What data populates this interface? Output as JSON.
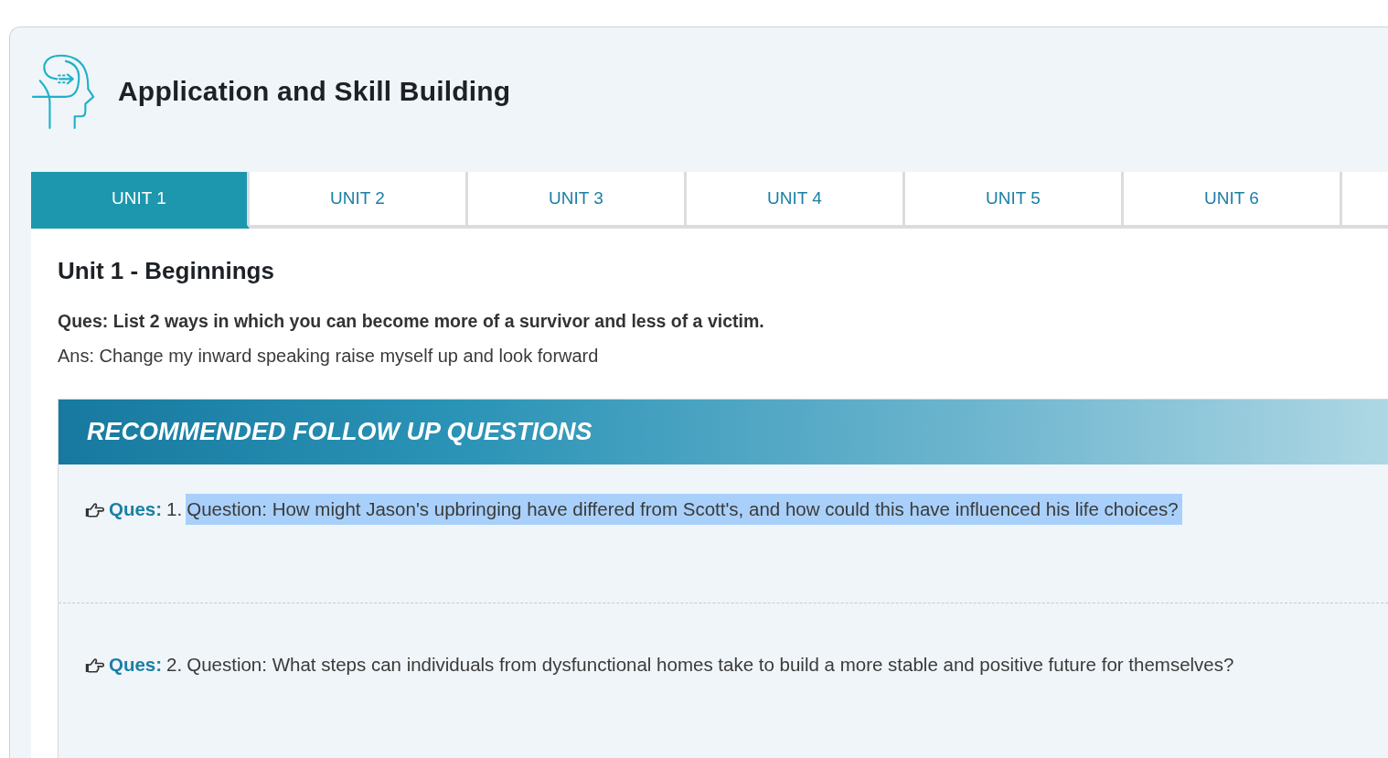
{
  "header": {
    "title": "Application and Skill Building"
  },
  "tabs": [
    {
      "label": "UNIT 1",
      "selected": true
    },
    {
      "label": "UNIT 2",
      "selected": false
    },
    {
      "label": "UNIT 3",
      "selected": false
    },
    {
      "label": "UNIT 4",
      "selected": false
    },
    {
      "label": "UNIT 5",
      "selected": false
    },
    {
      "label": "UNIT 6",
      "selected": false
    }
  ],
  "unit": {
    "title": "Unit 1 - Beginnings",
    "question": "Ques: List 2 ways in which you can become more of a survivor and less of a victim.",
    "answer": "Ans: Change my inward speaking raise myself up and look forward"
  },
  "followup": {
    "title": "RECOMMENDED FOLLOW UP QUESTIONS",
    "questions": [
      {
        "label": "Ques:",
        "number": "1.",
        "text": "Question: How might Jason's upbringing have differed from Scott's, and how could this have influenced his life choices?",
        "highlighted": true
      },
      {
        "label": "Ques:",
        "number": "2.",
        "text": "Question: What steps can individuals from dysfunctional homes take to build a more stable and positive future for themselves?",
        "highlighted": false
      }
    ]
  }
}
